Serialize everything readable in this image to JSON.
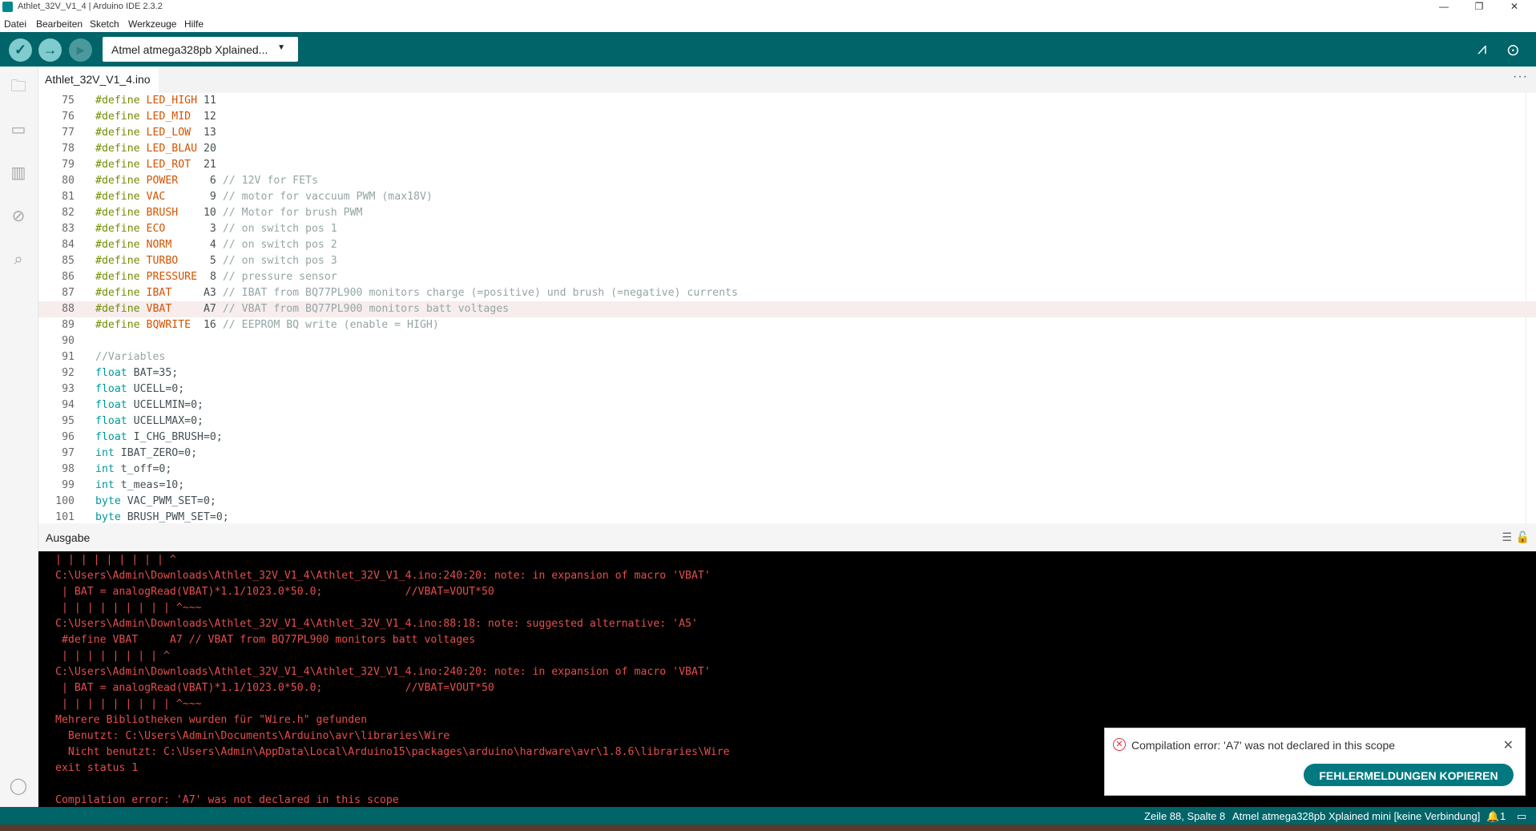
{
  "window": {
    "title": "Athlet_32V_V1_4 | Arduino IDE 2.3.2",
    "controls": [
      "—",
      "❐",
      "✕"
    ]
  },
  "menu": [
    "Datei",
    "Bearbeiten",
    "Sketch",
    "Werkzeuge",
    "Hilfe"
  ],
  "toolbar": {
    "board": "Atmel atmega328pb Xplained...",
    "icons": [
      "check-icon",
      "arrow-right-icon",
      "debug-icon",
      "serial-plotter-icon",
      "serial-monitor-icon"
    ]
  },
  "tab": {
    "label": "Athlet_32V_V1_4.ino",
    "more": "···"
  },
  "editor": {
    "current_line": "88",
    "lines": [
      {
        "n": "75",
        "p": [
          {
            "c": "kw",
            "t": "#define "
          },
          {
            "c": "mac",
            "t": "LED_HIGH"
          },
          {
            "c": "num",
            "t": " 11"
          }
        ]
      },
      {
        "n": "76",
        "p": [
          {
            "c": "kw",
            "t": "#define "
          },
          {
            "c": "mac",
            "t": "LED_MID"
          },
          {
            "c": "num",
            "t": "  12"
          }
        ]
      },
      {
        "n": "77",
        "p": [
          {
            "c": "kw",
            "t": "#define "
          },
          {
            "c": "mac",
            "t": "LED_LOW"
          },
          {
            "c": "num",
            "t": "  13"
          }
        ]
      },
      {
        "n": "78",
        "p": [
          {
            "c": "kw",
            "t": "#define "
          },
          {
            "c": "mac",
            "t": "LED_BLAU"
          },
          {
            "c": "num",
            "t": " 20"
          }
        ]
      },
      {
        "n": "79",
        "p": [
          {
            "c": "kw",
            "t": "#define "
          },
          {
            "c": "mac",
            "t": "LED_ROT"
          },
          {
            "c": "num",
            "t": "  21"
          }
        ]
      },
      {
        "n": "80",
        "p": [
          {
            "c": "kw",
            "t": "#define "
          },
          {
            "c": "mac",
            "t": "POWER"
          },
          {
            "c": "num",
            "t": "     6 "
          },
          {
            "c": "cm",
            "t": "// 12V for FETs"
          }
        ]
      },
      {
        "n": "81",
        "p": [
          {
            "c": "kw",
            "t": "#define "
          },
          {
            "c": "mac",
            "t": "VAC"
          },
          {
            "c": "num",
            "t": "       9 "
          },
          {
            "c": "cm",
            "t": "// motor for vaccuum PWM (max18V)"
          }
        ]
      },
      {
        "n": "82",
        "p": [
          {
            "c": "kw",
            "t": "#define "
          },
          {
            "c": "mac",
            "t": "BRUSH"
          },
          {
            "c": "num",
            "t": "    10 "
          },
          {
            "c": "cm",
            "t": "// Motor for brush PWM"
          }
        ]
      },
      {
        "n": "83",
        "p": [
          {
            "c": "kw",
            "t": "#define "
          },
          {
            "c": "mac",
            "t": "ECO"
          },
          {
            "c": "num",
            "t": "       3 "
          },
          {
            "c": "cm",
            "t": "// on switch pos 1"
          }
        ]
      },
      {
        "n": "84",
        "p": [
          {
            "c": "kw",
            "t": "#define "
          },
          {
            "c": "mac",
            "t": "NORM"
          },
          {
            "c": "num",
            "t": "      4 "
          },
          {
            "c": "cm",
            "t": "// on switch pos 2"
          }
        ]
      },
      {
        "n": "85",
        "p": [
          {
            "c": "kw",
            "t": "#define "
          },
          {
            "c": "mac",
            "t": "TURBO"
          },
          {
            "c": "num",
            "t": "     5 "
          },
          {
            "c": "cm",
            "t": "// on switch pos 3"
          }
        ]
      },
      {
        "n": "86",
        "p": [
          {
            "c": "kw",
            "t": "#define "
          },
          {
            "c": "mac",
            "t": "PRESSURE"
          },
          {
            "c": "num",
            "t": "  8 "
          },
          {
            "c": "cm",
            "t": "// pressure sensor"
          }
        ]
      },
      {
        "n": "87",
        "p": [
          {
            "c": "kw",
            "t": "#define "
          },
          {
            "c": "mac",
            "t": "IBAT"
          },
          {
            "c": "num",
            "t": "     A3 "
          },
          {
            "c": "cm",
            "t": "// IBAT from BQ77PL900 monitors charge (=positive) und brush (=negative) currents"
          }
        ]
      },
      {
        "n": "88",
        "p": [
          {
            "c": "kw",
            "t": "#define "
          },
          {
            "c": "mac",
            "t": "VBAT"
          },
          {
            "c": "num",
            "t": "     A7 "
          },
          {
            "c": "cm",
            "t": "// VBAT from BQ77PL900 monitors batt voltages"
          }
        ]
      },
      {
        "n": "89",
        "p": [
          {
            "c": "kw",
            "t": "#define "
          },
          {
            "c": "mac",
            "t": "BQWRITE"
          },
          {
            "c": "num",
            "t": "  16 "
          },
          {
            "c": "cm",
            "t": "// EEPROM BQ write (enable = HIGH)"
          }
        ]
      },
      {
        "n": "90",
        "p": []
      },
      {
        "n": "91",
        "p": [
          {
            "c": "cm",
            "t": "//Variables"
          }
        ]
      },
      {
        "n": "92",
        "p": [
          {
            "c": "ty",
            "t": "float"
          },
          {
            "c": "num",
            "t": " BAT=35;"
          }
        ]
      },
      {
        "n": "93",
        "p": [
          {
            "c": "ty",
            "t": "float"
          },
          {
            "c": "num",
            "t": " UCELL=0;"
          }
        ]
      },
      {
        "n": "94",
        "p": [
          {
            "c": "ty",
            "t": "float"
          },
          {
            "c": "num",
            "t": " UCELLMIN=0;"
          }
        ]
      },
      {
        "n": "95",
        "p": [
          {
            "c": "ty",
            "t": "float"
          },
          {
            "c": "num",
            "t": " UCELLMAX=0;"
          }
        ]
      },
      {
        "n": "96",
        "p": [
          {
            "c": "ty",
            "t": "float"
          },
          {
            "c": "num",
            "t": " I_CHG_BRUSH=0;"
          }
        ]
      },
      {
        "n": "97",
        "p": [
          {
            "c": "ty",
            "t": "int"
          },
          {
            "c": "num",
            "t": " IBAT_ZERO=0;"
          }
        ]
      },
      {
        "n": "98",
        "p": [
          {
            "c": "ty",
            "t": "int"
          },
          {
            "c": "num",
            "t": " t_off=0;"
          }
        ]
      },
      {
        "n": "99",
        "p": [
          {
            "c": "ty",
            "t": "int"
          },
          {
            "c": "num",
            "t": " t_meas=10;"
          }
        ]
      },
      {
        "n": "100",
        "p": [
          {
            "c": "ty",
            "t": "byte"
          },
          {
            "c": "num",
            "t": " VAC_PWM_SET=0;"
          }
        ]
      },
      {
        "n": "101",
        "p": [
          {
            "c": "ty",
            "t": "byte"
          },
          {
            "c": "num",
            "t": " BRUSH_PWM_SET=0;"
          }
        ]
      }
    ]
  },
  "output": {
    "title": "Ausgabe",
    "lines": [
      "| | | | | | | | | ^",
      "C:\\Users\\Admin\\Downloads\\Athlet_32V_V1_4\\Athlet_32V_V1_4.ino:240:20: note: in expansion of macro 'VBAT'",
      " | BAT = analogRead(VBAT)*1.1/1023.0*50.0;             //VBAT=VOUT*50",
      " | | | | | | | | | ^~~~",
      "C:\\Users\\Admin\\Downloads\\Athlet_32V_V1_4\\Athlet_32V_V1_4.ino:88:18: note: suggested alternative: 'A5'",
      " #define VBAT     A7 // VBAT from BQ77PL900 monitors batt voltages",
      " | | | | | | | | ^",
      "C:\\Users\\Admin\\Downloads\\Athlet_32V_V1_4\\Athlet_32V_V1_4.ino:240:20: note: in expansion of macro 'VBAT'",
      " | BAT = analogRead(VBAT)*1.1/1023.0*50.0;             //VBAT=VOUT*50",
      " | | | | | | | | | ^~~~",
      "Mehrere Bibliotheken wurden für \"Wire.h\" gefunden",
      "  Benutzt: C:\\Users\\Admin\\Documents\\Arduino\\avr\\libraries\\Wire",
      "  Nicht benutzt: C:\\Users\\Admin\\AppData\\Local\\Arduino15\\packages\\arduino\\hardware\\avr\\1.8.6\\libraries\\Wire",
      "exit status 1",
      "",
      "Compilation error: 'A7' was not declared in this scope"
    ]
  },
  "toast": {
    "message": "Compilation error: 'A7' was not declared in this scope",
    "button": "FEHLERMELDUNGEN KOPIEREN"
  },
  "status": {
    "position": "Zeile 88, Spalte 8",
    "board": "Atmel atmega328pb Xplained mini [keine Verbindung]",
    "notifications": "1"
  },
  "colors": {
    "accent": "#006468",
    "error": "#e54e4e"
  }
}
